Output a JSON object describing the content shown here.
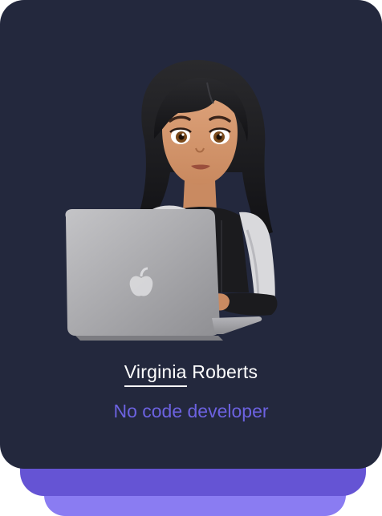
{
  "profile": {
    "first_name": "Virginia",
    "last_name": "Roberts",
    "role": "No code developer",
    "avatar_icon": "woman-technologist-icon"
  },
  "colors": {
    "card_background": "#23283d",
    "role_text": "#6c62e0",
    "stack_layer_1": "#6554d4",
    "stack_layer_2": "#8a7cf2"
  }
}
